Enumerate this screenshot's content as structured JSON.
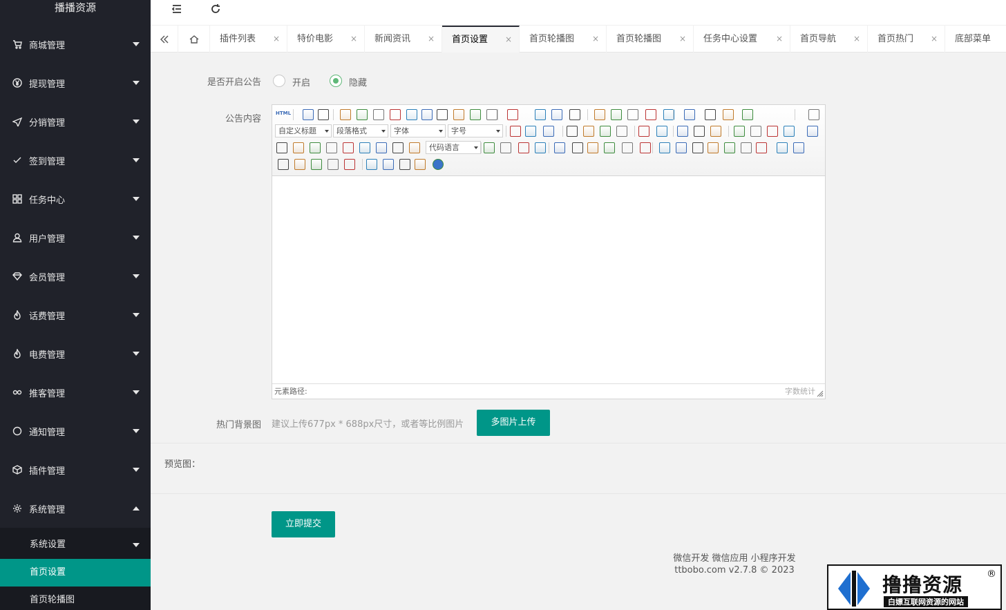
{
  "app": {
    "title": "播播资源"
  },
  "sidebar": {
    "items": [
      {
        "label": "商城管理",
        "icon": "cart-icon"
      },
      {
        "label": "提现管理",
        "icon": "yen-icon"
      },
      {
        "label": "分销管理",
        "icon": "send-icon"
      },
      {
        "label": "签到管理",
        "icon": "check-icon"
      },
      {
        "label": "任务中心",
        "icon": "apps-icon"
      },
      {
        "label": "用户管理",
        "icon": "user-icon"
      },
      {
        "label": "会员管理",
        "icon": "diamond-icon"
      },
      {
        "label": "话费管理",
        "icon": "fire-icon"
      },
      {
        "label": "电费管理",
        "icon": "fire-icon"
      },
      {
        "label": "推客管理",
        "icon": "link-icon"
      },
      {
        "label": "通知管理",
        "icon": "bubble-icon"
      },
      {
        "label": "插件管理",
        "icon": "cube-icon"
      },
      {
        "label": "系统管理",
        "icon": "gear-icon"
      }
    ],
    "submenu": [
      {
        "label": "系统设置"
      },
      {
        "label": "首页设置"
      },
      {
        "label": "首页轮播图"
      }
    ]
  },
  "tabs": [
    {
      "label": "插件列表"
    },
    {
      "label": "特价电影"
    },
    {
      "label": "新闻资讯"
    },
    {
      "label": "首页设置"
    },
    {
      "label": "首页轮播图"
    },
    {
      "label": "首页轮播图"
    },
    {
      "label": "任务中心设置"
    },
    {
      "label": "首页导航"
    },
    {
      "label": "首页热门"
    },
    {
      "label": "底部菜单"
    }
  ],
  "tab_close": "×",
  "form": {
    "notice_toggle": {
      "label": "是否开启公告",
      "option_on": "开启",
      "option_off": "隐藏",
      "selected": "隐藏"
    },
    "notice_content": {
      "label": "公告内容"
    },
    "editor": {
      "selects": [
        "自定义标题",
        "段落格式",
        "字体",
        "字号",
        "代码语言"
      ],
      "status_path": "元素路径:",
      "word_count": "字数统计",
      "html_label": "HTML"
    },
    "hot_bg": {
      "label": "热门背景图",
      "hint": "建议上传677px * 688px尺寸，或者等比例图片",
      "upload_button": "多图片上传"
    },
    "preview": {
      "label": "预览图："
    },
    "submit_button": "立即提交"
  },
  "footer": {
    "line1": "微信开发 微信应用 小程序开发",
    "line2": "ttbobo.com v2.7.8 © 2023"
  },
  "watermark": {
    "text": "撸撸资源",
    "sub": "白嫖互联网资源的网站",
    "reg": "®"
  },
  "colors": {
    "sidebar_bg": "#20222a",
    "accent": "#009688",
    "radio_on": "#5fb878"
  }
}
